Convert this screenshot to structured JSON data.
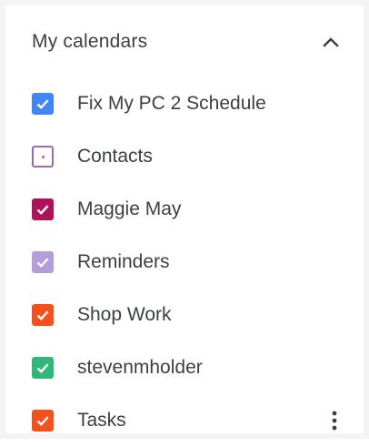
{
  "section": {
    "title": "My calendars",
    "collapse_icon": "chevron-up-icon"
  },
  "calendars": [
    {
      "label": "Fix My PC 2 Schedule",
      "checked": true,
      "color": "#4285f4"
    },
    {
      "label": "Contacts",
      "checked": false,
      "color": "#9e69af"
    },
    {
      "label": "Maggie May",
      "checked": true,
      "color": "#ad1457"
    },
    {
      "label": "Reminders",
      "checked": true,
      "color": "#b39ddb"
    },
    {
      "label": "Shop Work",
      "checked": true,
      "color": "#f4511e"
    },
    {
      "label": "stevenmholder",
      "checked": true,
      "color": "#33b679"
    },
    {
      "label": "Tasks",
      "checked": true,
      "color": "#f4511e",
      "options_icon": "more-vert-icon"
    }
  ]
}
